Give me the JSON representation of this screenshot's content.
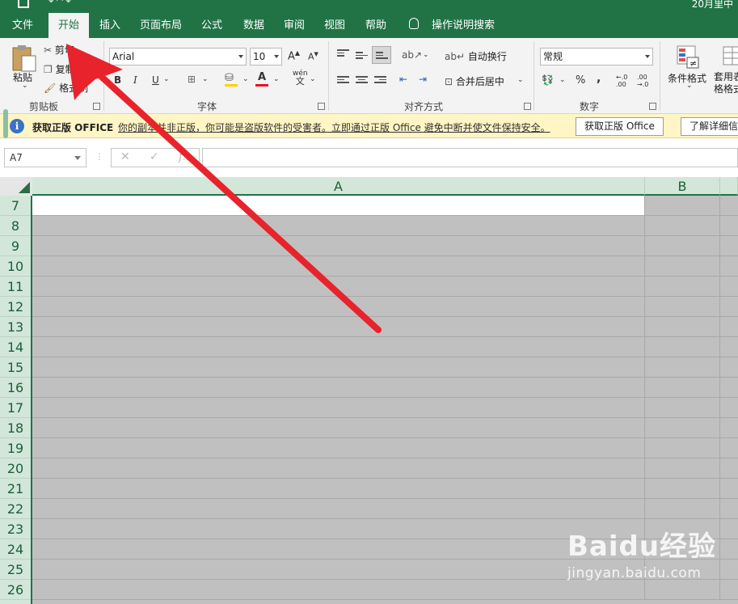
{
  "title_bar": {
    "title": "20月里中"
  },
  "tabs": [
    {
      "label": "文件"
    },
    {
      "label": "开始"
    },
    {
      "label": "插入"
    },
    {
      "label": "页面布局"
    },
    {
      "label": "公式"
    },
    {
      "label": "数据"
    },
    {
      "label": "审阅"
    },
    {
      "label": "视图"
    },
    {
      "label": "帮助"
    },
    {
      "label": "操作说明搜索"
    }
  ],
  "ribbon": {
    "clipboard": {
      "paste": "粘贴",
      "cut": "剪切",
      "copy": "复制",
      "format_painter": "格式刷",
      "label": "剪贴板"
    },
    "font": {
      "family": "Arial",
      "size": "10",
      "grow": "A",
      "shrink": "A",
      "bold": "B",
      "italic": "I",
      "underline": "U",
      "phonetic": "wén",
      "phonetic_char": "文",
      "label": "字体",
      "font_color": "#e81123",
      "fill_color": "#ffd200"
    },
    "alignment": {
      "wrap": "自动换行",
      "merge": "合并后居中",
      "label": "对齐方式"
    },
    "number": {
      "format": "常规",
      "percent": "%",
      "comma": ",",
      "inc_decimal": "←.0 .00",
      "dec_decimal": ".00 →.0",
      "label": "数字"
    },
    "styles": {
      "conditional": "条件格式",
      "table_format": "套用表格格式"
    }
  },
  "warning": {
    "title": "获取正版 OFFICE",
    "message": "你的副本并非正版，你可能是盗版软件的受害者。立即通过正版 Office 避免中断并使文件保持安全。",
    "button_get": "获取正版 Office",
    "button_more": "了解详细信息"
  },
  "formula_bar": {
    "name_box": "A7",
    "cancel": "✕",
    "enter": "✓",
    "fx": "fx",
    "value": ""
  },
  "grid": {
    "columns": [
      "A",
      "B"
    ],
    "rows": [
      "7",
      "8",
      "9",
      "10",
      "11",
      "12",
      "13",
      "14",
      "15",
      "16",
      "17",
      "18",
      "19",
      "20",
      "21",
      "22",
      "23",
      "24",
      "25",
      "26"
    ]
  },
  "watermark": {
    "logo": "Baidu经验",
    "url": "jingyan.baidu.com"
  },
  "colors": {
    "accent": "#217346",
    "arrow": "#e8232b",
    "selection_gray": "#c0c0c0"
  }
}
